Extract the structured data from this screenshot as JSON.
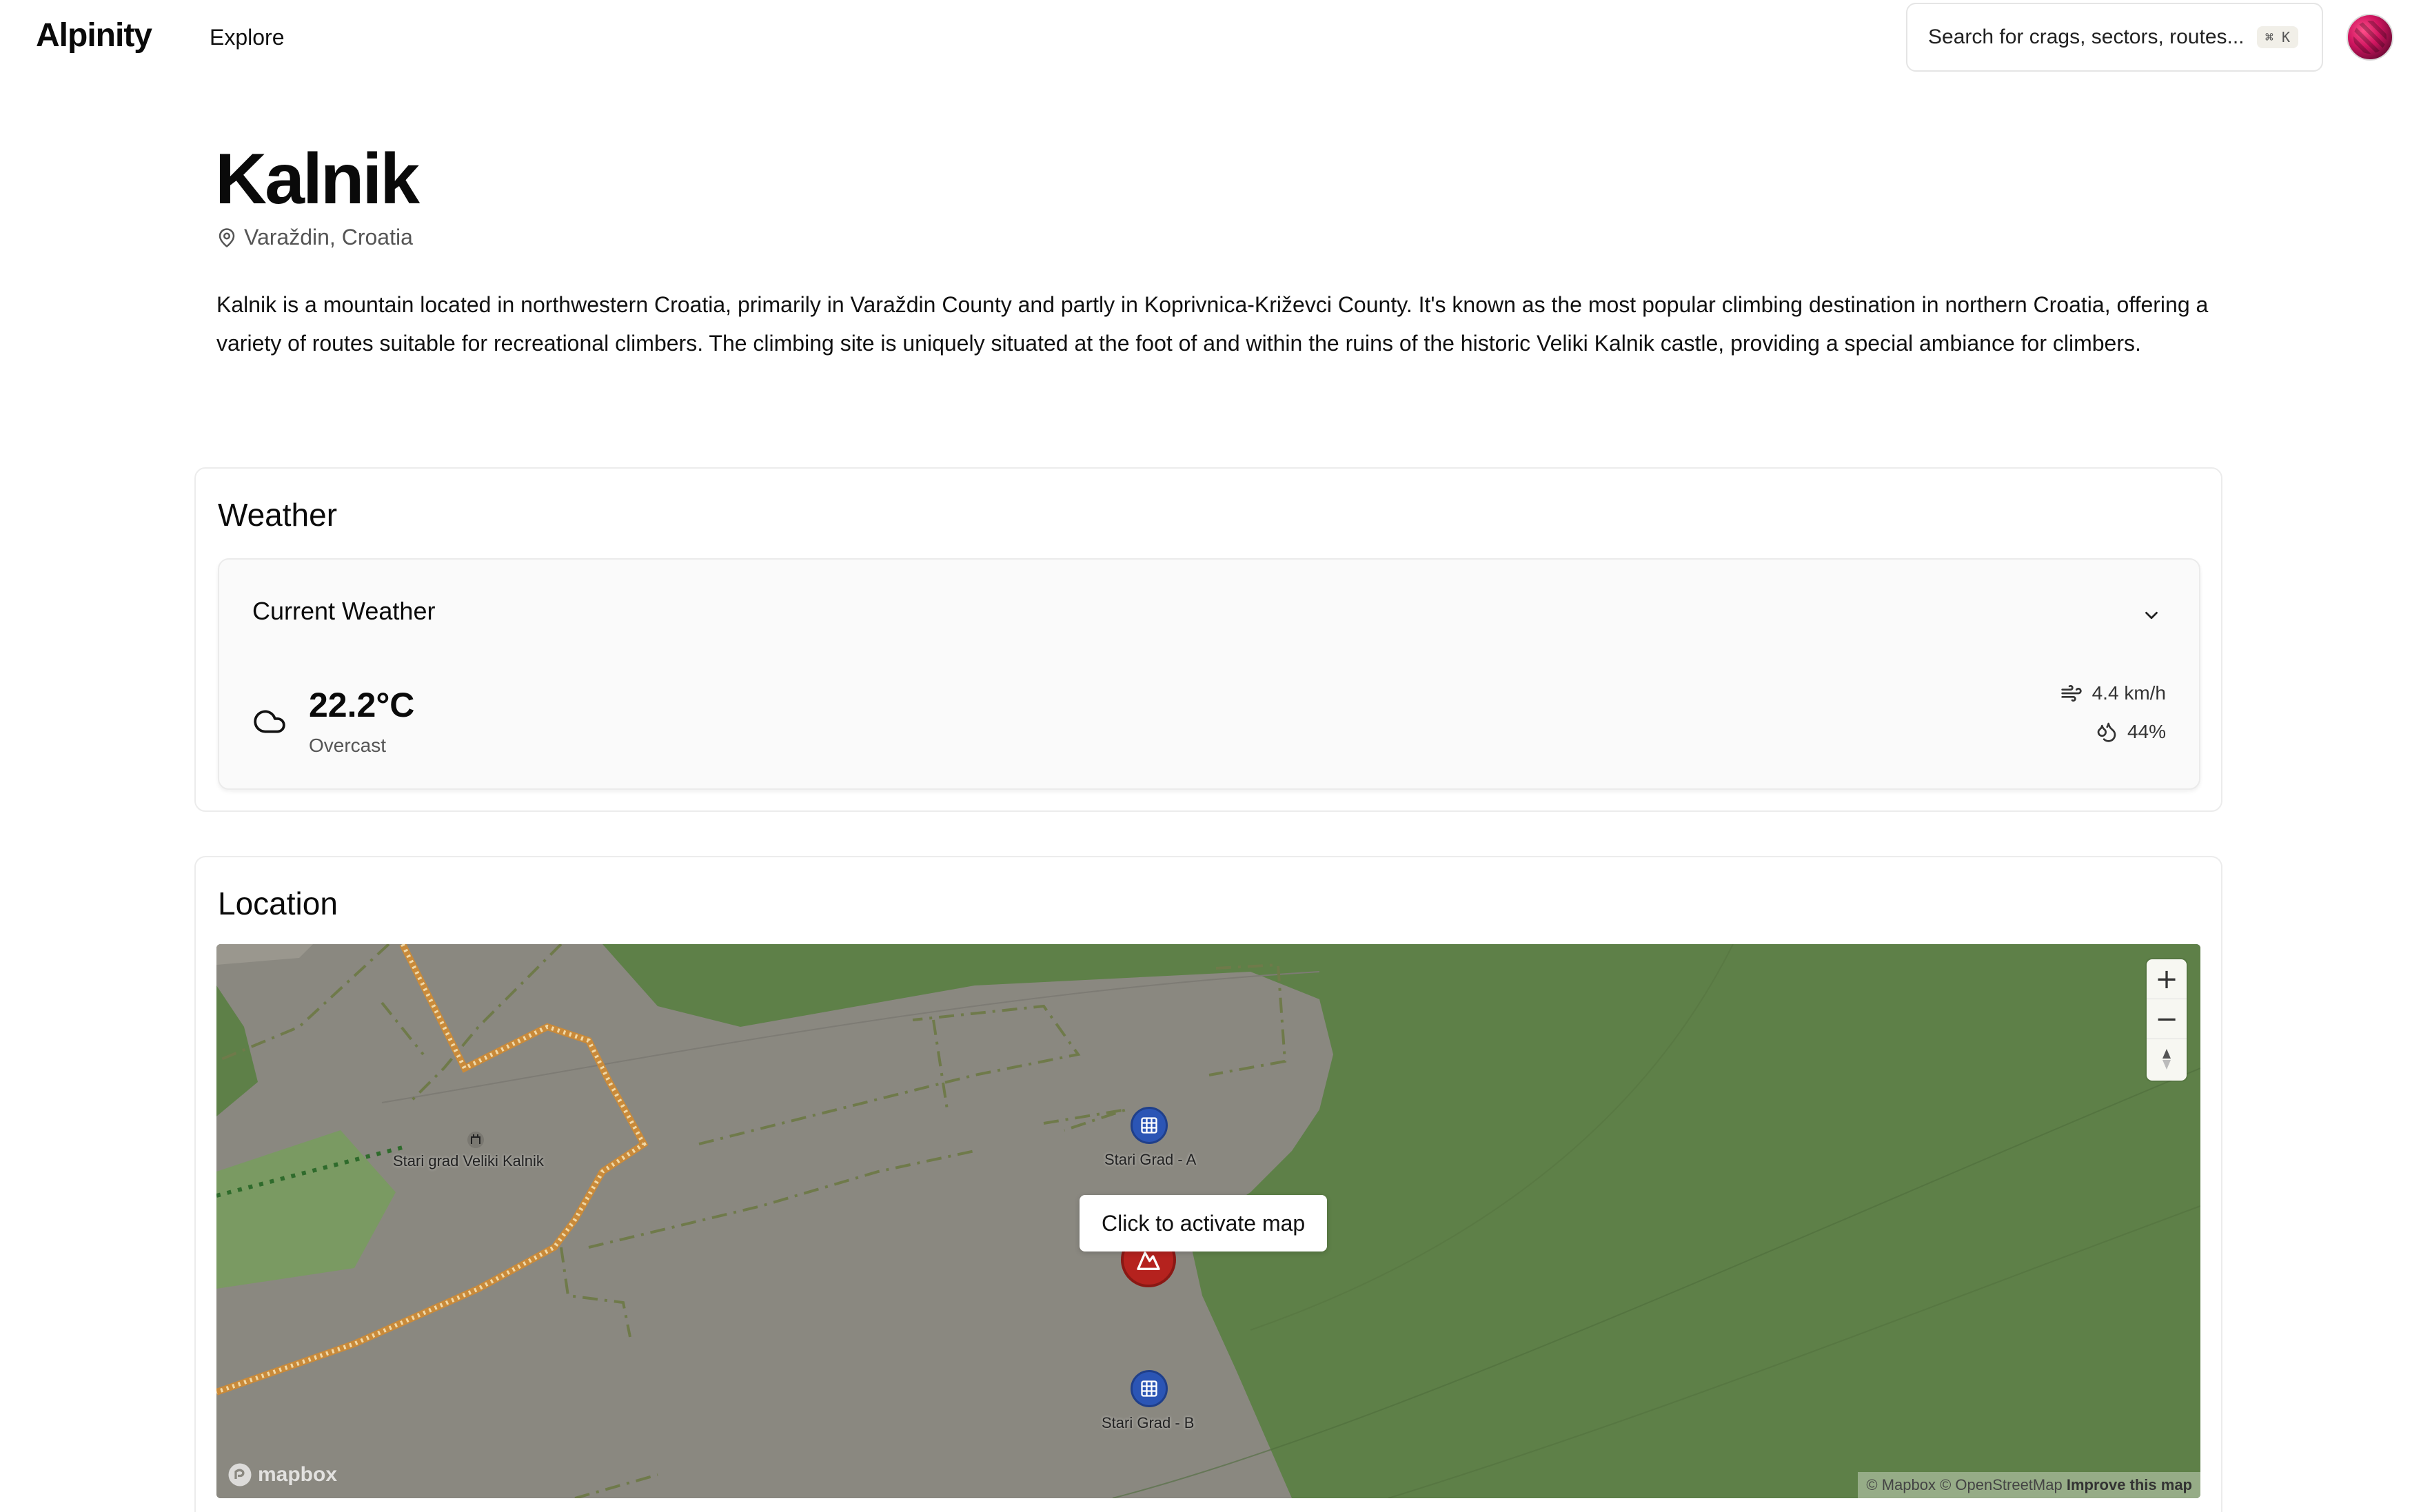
{
  "header": {
    "logo": "Alpinity",
    "nav_explore": "Explore",
    "search_placeholder": "Search for crags, sectors, routes...",
    "search_shortcut": "⌘ K"
  },
  "crag": {
    "title": "Kalnik",
    "location": "Varaždin, Croatia",
    "description": "Kalnik is a mountain located in northwestern Croatia, primarily in Varaždin County and partly in Koprivnica-Križevci County. It's known as the most popular climbing destination in northern Croatia, offering a variety of routes suitable for recreational climbers. The climbing site is uniquely situated at the foot of and within the ruins of the historic Veliki Kalnik castle, providing a special ambiance for climbers."
  },
  "weather": {
    "section_title": "Weather",
    "panel_title": "Current Weather",
    "temperature": "22.2°C",
    "condition": "Overcast",
    "wind": "4.4 km/h",
    "humidity": "44%"
  },
  "location": {
    "section_title": "Location",
    "activate_label": "Click to activate map",
    "poi_label": "Stari grad Veliki Kalnik",
    "sector_a": "Stari Grad - A",
    "sector_b": "Stari Grad - B",
    "mapbox_logo": "mapbox",
    "attribution_text": "© Mapbox © OpenStreetMap",
    "attribution_link": "Improve this map",
    "zoom_in": "+",
    "zoom_out": "−"
  },
  "colors": {
    "map_base": "#8a8880",
    "forest": "#5e8048",
    "trail": "#c98a3a",
    "sector_marker": "#2b55b5",
    "crag_marker": "#b5221e"
  }
}
